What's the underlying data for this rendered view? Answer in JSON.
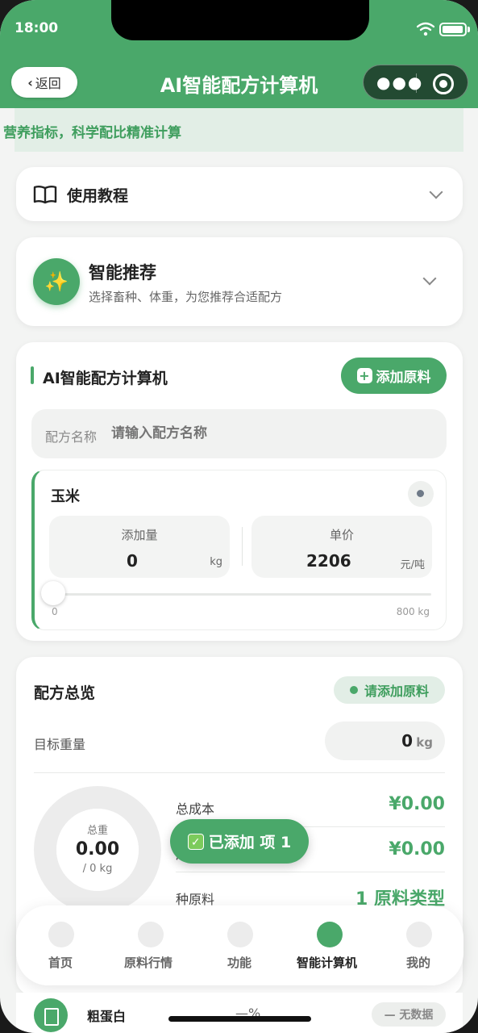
{
  "status": {
    "time": "18:00"
  },
  "nav": {
    "back_label": "返回",
    "title": "AI智能配方计算机"
  },
  "banner": {
    "text": "营养指标，科学配比精准计算"
  },
  "tutorial": {
    "label": "使用教程"
  },
  "recommend": {
    "title": "智能推荐",
    "subtitle": "选择畜种、体重，为您推荐合适配方"
  },
  "calculator": {
    "title": "AI智能配方计算机",
    "add_button": "添加原料",
    "name_label": "配方名称",
    "name_placeholder": "请输入配方名称",
    "ingredient": {
      "name": "玉米",
      "amount_label": "添加量",
      "amount_value": "0",
      "amount_unit": "kg",
      "price_label": "单价",
      "price_value": "2206",
      "price_unit": "元/吨",
      "slider_min": "0",
      "slider_max": "800 kg",
      "slider_level": 0
    }
  },
  "overview": {
    "title": "配方总览",
    "hint": "请添加原料",
    "target_label": "目标重量",
    "target_value": "0",
    "target_unit": "kg",
    "donut_label": "总重",
    "donut_value": "0.00",
    "donut_sub": "/ 0 kg",
    "stats": [
      {
        "label": "总成本",
        "value": "¥0.00"
      },
      {
        "label": "成本",
        "value": "¥0.00"
      },
      {
        "label": "种原料",
        "value": "1 原料类型"
      }
    ]
  },
  "toast": {
    "text": "已添加 项 1"
  },
  "tabbar": {
    "tabs": [
      {
        "label": "首页",
        "icon": "home-icon",
        "active": false
      },
      {
        "label": "原料行情",
        "icon": "market-icon",
        "active": false
      },
      {
        "label": "功能",
        "icon": "grid-icon",
        "active": false
      },
      {
        "label": "智能计算机",
        "icon": "calculator-icon",
        "active": true
      },
      {
        "label": "我的",
        "icon": "user-icon",
        "active": false
      }
    ]
  },
  "nutrient_row": {
    "name": "粗蛋白",
    "percent": "—%",
    "status": "— 无数据"
  },
  "colors": {
    "brand": "#4aa86a",
    "brand_light": "#e2eee6",
    "background": "#f3f4f3"
  }
}
